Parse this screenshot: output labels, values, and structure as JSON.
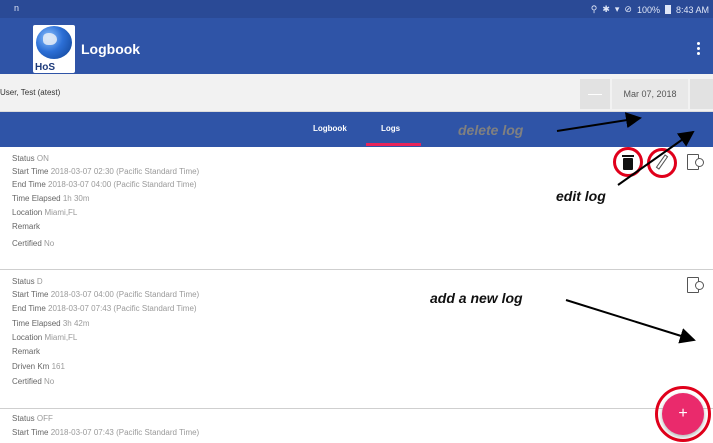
{
  "status_bar": {
    "left_glyph": "n",
    "right_text": "100%",
    "time": "8:43 AM"
  },
  "app_bar": {
    "logo_text": "HoS",
    "title": "Logbook"
  },
  "user_bar": {
    "user": "User, Test (atest)",
    "prev_label": "—",
    "date": "Mar 07, 2018"
  },
  "tabs": [
    {
      "label": "Logbook",
      "selected": false
    },
    {
      "label": "Logs",
      "selected": true
    }
  ],
  "colors": {
    "primary": "#2f54a7",
    "accent": "#e8245a",
    "fab": "#ea2a6c",
    "annotation_ring": "#e0001b"
  },
  "logs": [
    {
      "status_label": "Status",
      "status": "ON",
      "start_label": "Start Time",
      "start": "2018-03-07 02:30 (Pacific Standard Time)",
      "end_label": "End Time",
      "end": "2018-03-07 04:00 (Pacific Standard Time)",
      "elapsed_label": "Time Elapsed",
      "elapsed": "1h 30m",
      "location_label": "Location",
      "location": "Miami,FL",
      "remark_label": "Remark",
      "certified_label": "Certified",
      "certified": "No"
    },
    {
      "status_label": "Status",
      "status": "D",
      "start_label": "Start Time",
      "start": "2018-03-07 04:00 (Pacific Standard Time)",
      "end_label": "End Time",
      "end": "2018-03-07 07:43 (Pacific Standard Time)",
      "elapsed_label": "Time Elapsed",
      "elapsed": "3h 42m",
      "location_label": "Location",
      "location": "Miami,FL",
      "remark_label": "Remark",
      "driven_label": "Driven Km",
      "driven": "161",
      "certified_label": "Certified",
      "certified": "No"
    },
    {
      "status_label": "Status",
      "status": "OFF",
      "start_label": "Start Time",
      "start": "2018-03-07 07:43 (Pacific Standard Time)"
    }
  ],
  "fab": {
    "label": "+"
  },
  "annotations": {
    "delete": "delete log",
    "edit": "edit log",
    "add": "add a new log"
  },
  "icons": [
    "delete-icon",
    "edit-icon",
    "assign-document-icon",
    "add-icon",
    "menu-kebab-icon",
    "location-icon",
    "bluetooth-icon",
    "wifi-icon",
    "alarm-icon",
    "battery-icon"
  ]
}
